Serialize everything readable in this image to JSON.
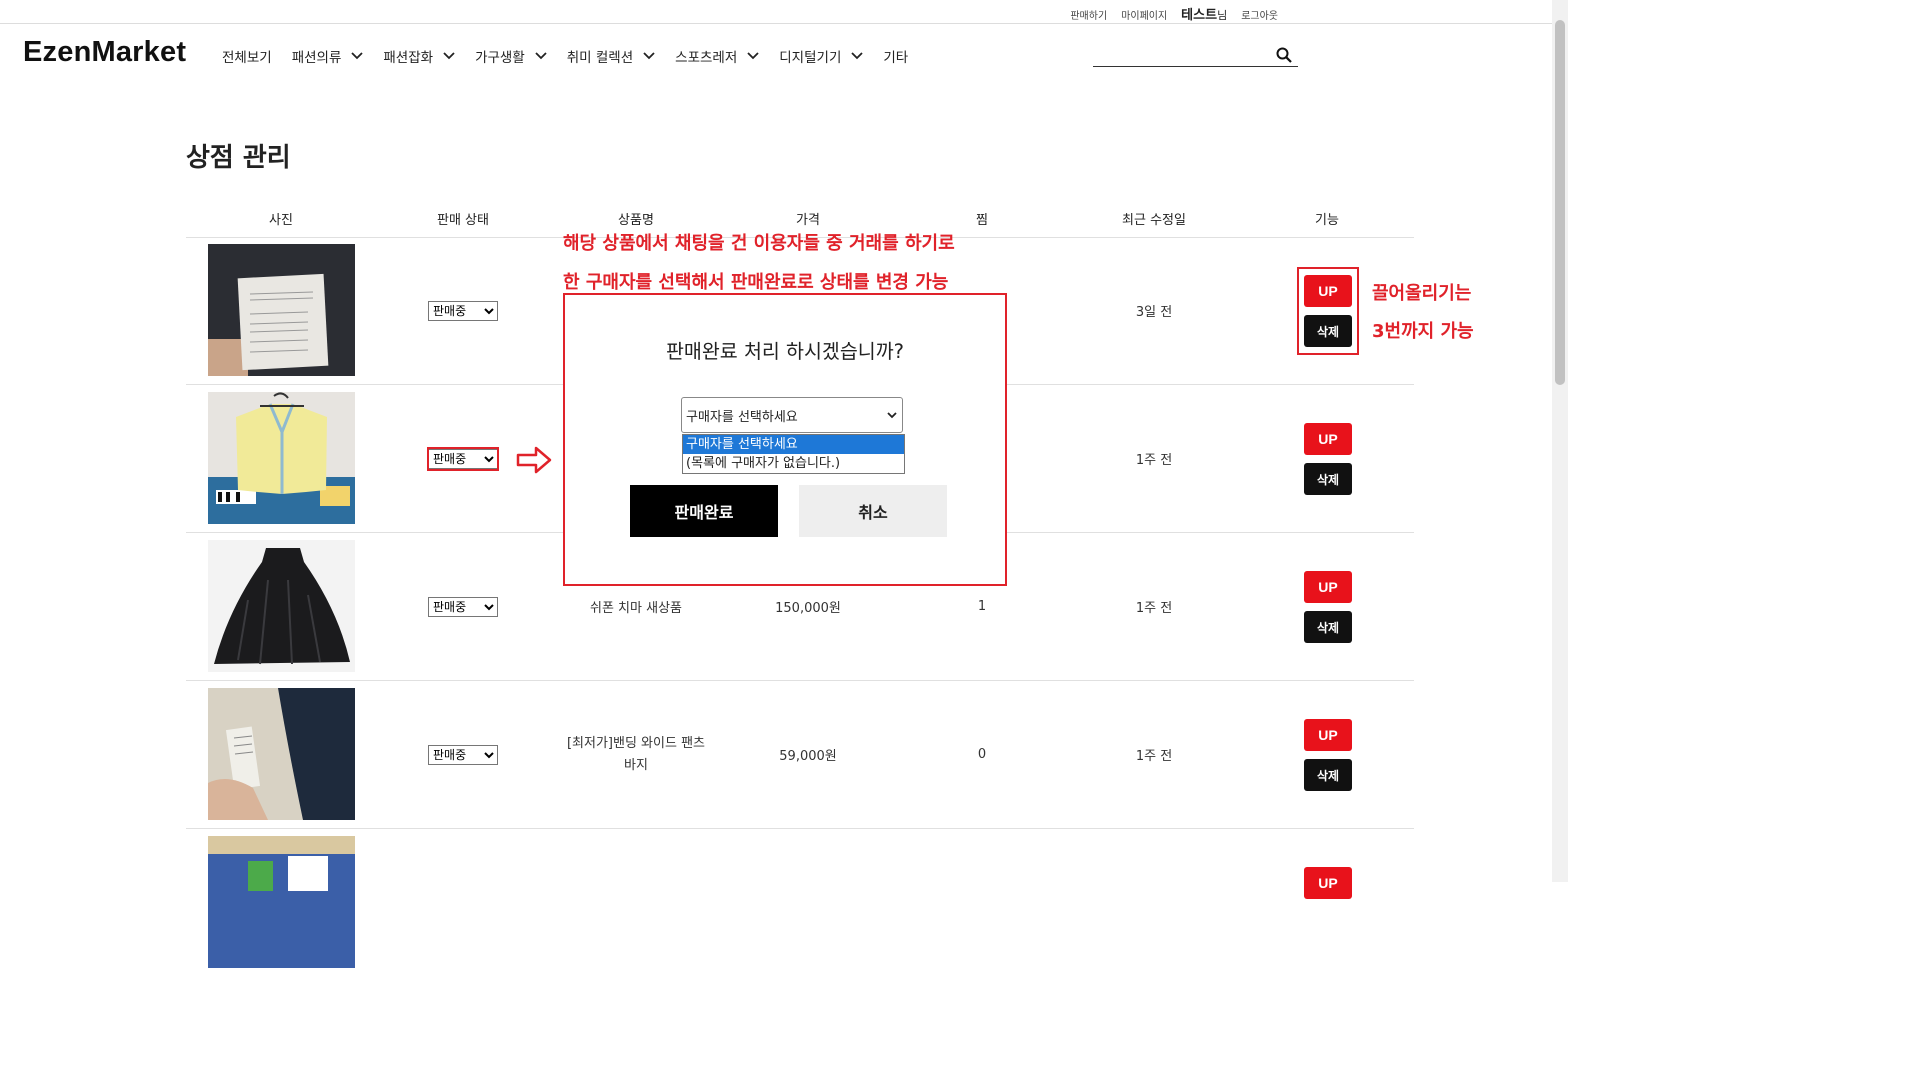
{
  "topbar": {
    "sell": "판매하기",
    "mypage": "마이페이지",
    "user_name": "테스트",
    "user_suffix": "님",
    "logout": "로그아웃"
  },
  "logo": "EzenMarket",
  "nav": [
    {
      "label": "전체보기",
      "dropdown": false
    },
    {
      "label": "패션의류",
      "dropdown": true
    },
    {
      "label": "패션잡화",
      "dropdown": true
    },
    {
      "label": "가구생활",
      "dropdown": true
    },
    {
      "label": "취미 컬렉션",
      "dropdown": true
    },
    {
      "label": "스포츠레저",
      "dropdown": true
    },
    {
      "label": "디지털기기",
      "dropdown": true
    },
    {
      "label": "기타",
      "dropdown": false
    }
  ],
  "search": {
    "placeholder": "",
    "value": ""
  },
  "page_title": "상점 관리",
  "table": {
    "headers": {
      "photo": "사진",
      "status": "판매 상태",
      "name": "상품명",
      "price": "가격",
      "likes": "찜",
      "updated": "최근 수정일",
      "actions": "기능"
    },
    "rows": [
      {
        "status": "판매중",
        "name": "",
        "price": "",
        "likes": "",
        "updated": "3일 전"
      },
      {
        "status": "판매중",
        "name": "",
        "price": "",
        "likes": "",
        "updated": "1주 전"
      },
      {
        "status": "판매중",
        "name": "쉬폰 치마 새상품",
        "price": "150,000원",
        "likes": "1",
        "updated": "1주 전"
      },
      {
        "status": "판매중",
        "name": "[최저가]밴딩 와이드 팬츠 바지",
        "price": "59,000원",
        "likes": "0",
        "updated": "1주 전"
      },
      {
        "status": "",
        "name": "",
        "price": "",
        "likes": "",
        "updated": ""
      }
    ],
    "up_label": "UP",
    "delete_label": "삭제"
  },
  "modal": {
    "question": "판매완료 처리 하시겠습니까?",
    "select_value": "구매자를 선택하세요",
    "options": [
      "구매자를 선택하세요",
      "(목록에 구매자가 없습니다.)"
    ],
    "confirm": "판매완료",
    "cancel": "취소"
  },
  "annotations": {
    "line1": "해당 상품에서 채팅을 건 이용자들 중 거래를 하기로",
    "line2": "한 구매자를 선택해서 판매완료로 상태를 변경 가능",
    "up_note1": "끌어올리기는",
    "up_note2": "3번까지 가능",
    "color": "#e0222a"
  },
  "colors": {
    "up_button": "#e8121b",
    "delete_button": "#111111",
    "option_highlight": "#1e78d7"
  }
}
